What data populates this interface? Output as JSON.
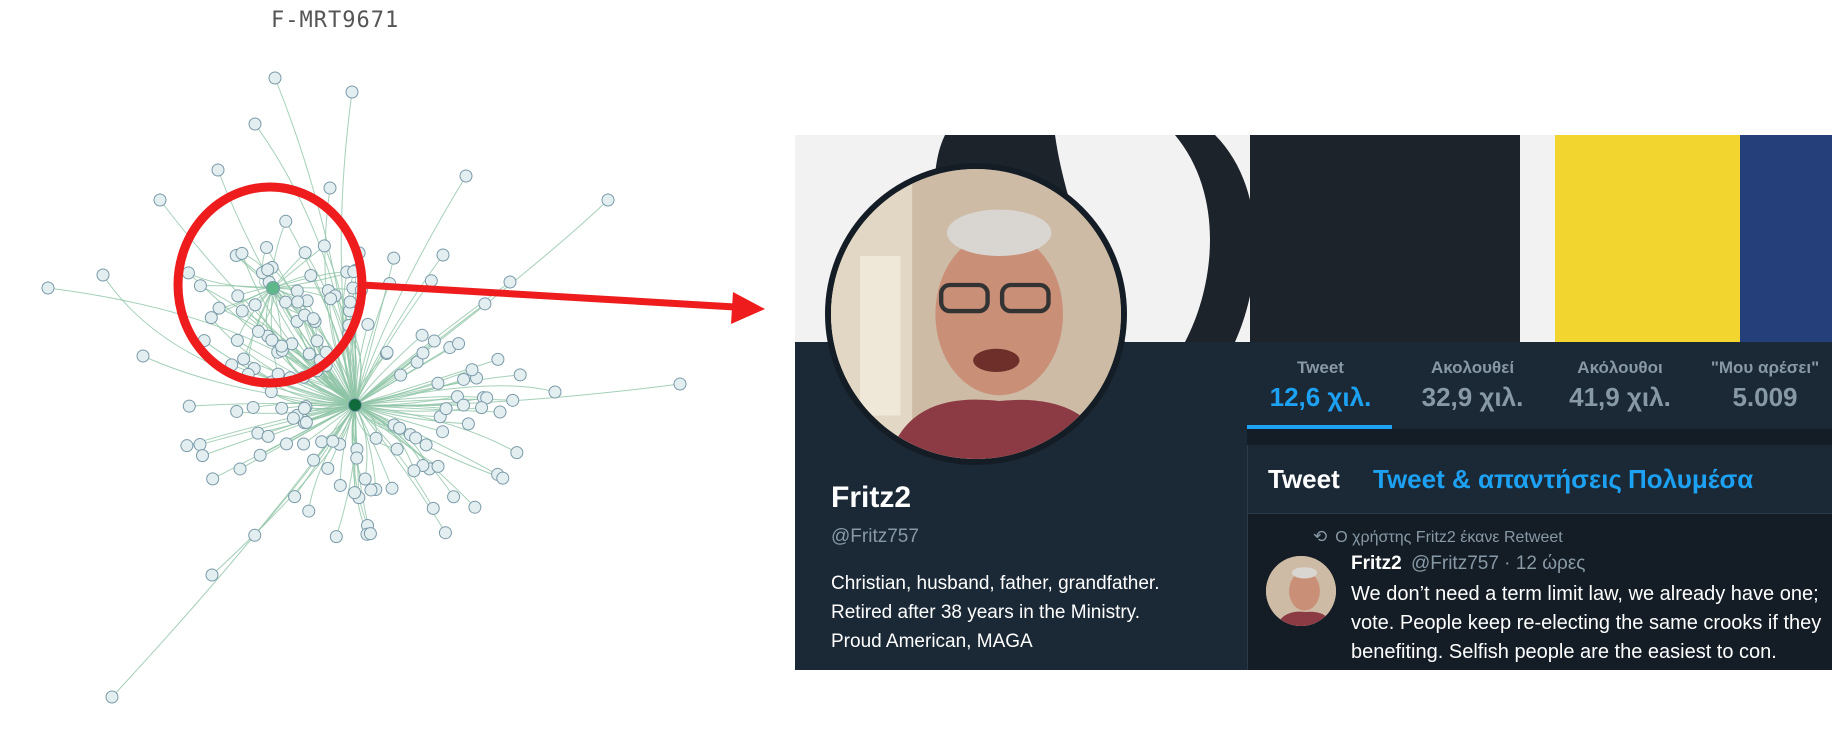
{
  "graph": {
    "label": "F-MRT9671",
    "colors": {
      "edge": "#8fc4a6",
      "node_fill": "#e3eef0",
      "node_stroke": "#7a9aa8",
      "hub": "#0f6b3b",
      "sub_hub": "#5fb88a",
      "highlight": "#ee1c1c"
    }
  },
  "profile": {
    "stats": [
      {
        "label": "Tweet",
        "value": "12,6 χιλ.",
        "active": true
      },
      {
        "label": "Ακολουθεί",
        "value": "32,9 χιλ.",
        "active": false
      },
      {
        "label": "Ακόλουθοι",
        "value": "41,9 χιλ.",
        "active": false
      },
      {
        "label": "\"Μου αρέσει\"",
        "value": "5.009",
        "active": false
      }
    ],
    "name": "Fritz2",
    "handle": "@Fritz757",
    "bio": [
      "Christian, husband, father, grandfather.",
      "Retired after 38 years in the Ministry.",
      "Proud American, MAGA"
    ],
    "tabs": [
      "Tweet",
      "Tweet & απαντήσεις",
      "Πολυμέσα"
    ],
    "tweet": {
      "retweet_note": "Ο χρήστης Fritz2 έκανε Retweet",
      "retweet_icon": "retweet-icon",
      "author": "Fritz2",
      "author_handle": "@Fritz757",
      "time": "· 12 ώρες",
      "lines": [
        "We don’t need a term limit law, we already have one;",
        "vote. People keep re-electing the same crooks if they",
        "benefiting. Selfish people are the easiest to con."
      ]
    },
    "colors": {
      "accent": "#1da1f2",
      "bg": "#141d26",
      "panel": "#1b2836",
      "muted": "#8899a6"
    }
  }
}
